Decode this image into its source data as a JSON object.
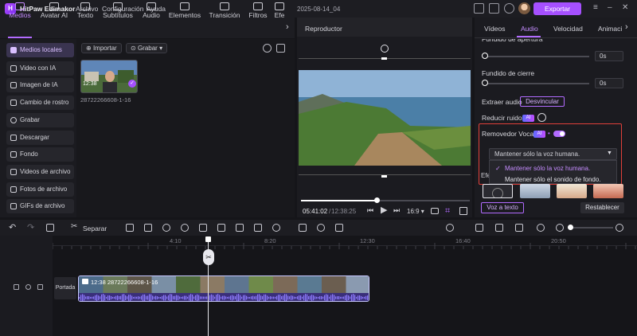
{
  "titlebar": {
    "app_name": "HitPaw Edimakor",
    "menus": [
      "Archivo",
      "Configuración",
      "Ayuda"
    ],
    "project_title": "2025-08-14_04",
    "export_label": "Exportar"
  },
  "tool_tabs": [
    {
      "label": "Medios",
      "icon": "folder-icon"
    },
    {
      "label": "Avatar AI",
      "icon": "avatar-icon"
    },
    {
      "label": "Texto",
      "icon": "text-icon"
    },
    {
      "label": "Subtítulos",
      "icon": "subtitles-icon"
    },
    {
      "label": "Audio",
      "icon": "music-icon"
    },
    {
      "label": "Elementos",
      "icon": "elements-icon"
    },
    {
      "label": "Transición",
      "icon": "transition-icon"
    },
    {
      "label": "Filtros",
      "icon": "filters-icon"
    },
    {
      "label": "Efe",
      "icon": "effects-icon"
    }
  ],
  "left_nav": [
    "Medios locales",
    "Video con IA",
    "Imagen de IA",
    "Cambio de rostro",
    "Grabar",
    "Descargar",
    "Fondo",
    "Videos de archivo",
    "Fotos de archivo",
    "GIFs de archivo"
  ],
  "media": {
    "import_label": "Importar",
    "record_label": "Grabar",
    "thumb_duration": "12:38",
    "thumb_name": "28722266608-1-16"
  },
  "player": {
    "title": "Reproductor",
    "time_current": "05:41:02",
    "time_total": "12:38:25",
    "aspect": "16:9",
    "progress": 0.45
  },
  "right_panel": {
    "tabs": [
      "Vídeos",
      "Audio",
      "Velocidad",
      "Animación"
    ],
    "fundido_apertura_label": "Fundido de apertura",
    "fundido_apertura_value": "0s",
    "fundido_cierre_label": "Fundido de cierre",
    "fundido_cierre_value": "0s",
    "extraer_label": "Extraer audio",
    "desvincular_label": "Desvincular",
    "reducir_label": "Reducir ruido",
    "ai_badge": "AI",
    "removedor_label": "Removedor Vocal",
    "select_value": "Mantener sólo la voz humana.",
    "options": [
      "Mantener sólo la voz humana.",
      "Mantener sólo el sonido de fondo."
    ],
    "check_glyph": "✓",
    "efe_label": "Efe",
    "voz_label": "Voz a texto",
    "reset_label": "Restablecer"
  },
  "timeline": {
    "split_label": "Separar",
    "ruler": [
      "4:10",
      "8:20",
      "12:30",
      "16:40",
      "20:50"
    ],
    "portada_label": "Portada",
    "clip_label": "12:38  28722266608-1-16"
  },
  "colors": {
    "accent": "#a650ff",
    "highlight_box": "#e0403a"
  }
}
